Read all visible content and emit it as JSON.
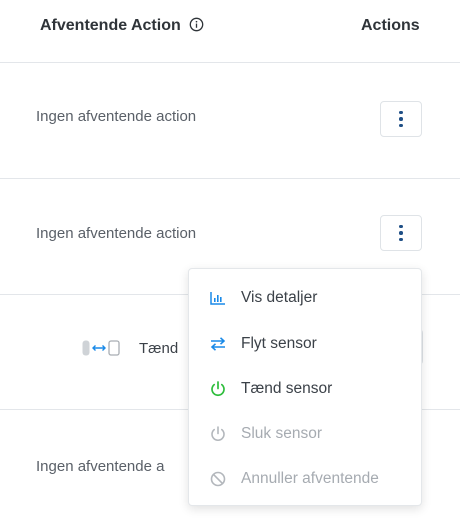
{
  "table": {
    "headers": {
      "pending_action": "Afventende Action",
      "actions": "Actions"
    },
    "rows": [
      {
        "pending_text": "Ingen afventende action"
      },
      {
        "pending_text": "Ingen afventende action"
      },
      {
        "pending_text": "Tænd"
      },
      {
        "pending_text": "Ingen afventende a"
      }
    ]
  },
  "menu": {
    "items": [
      {
        "label": "Vis detaljer",
        "icon": "bar-chart-icon",
        "enabled": true
      },
      {
        "label": "Flyt sensor",
        "icon": "swap-arrows-icon",
        "enabled": true
      },
      {
        "label": "Tænd sensor",
        "icon": "power-icon",
        "enabled": true
      },
      {
        "label": "Sluk sensor",
        "icon": "power-icon",
        "enabled": false
      },
      {
        "label": "Annuller afventende",
        "icon": "cancel-icon",
        "enabled": false
      }
    ]
  },
  "colors": {
    "accent_blue": "#1a8ae8",
    "kebab_navy": "#1f4f86",
    "power_green": "#2ebd3c",
    "disabled_gray": "#a6abb1"
  }
}
